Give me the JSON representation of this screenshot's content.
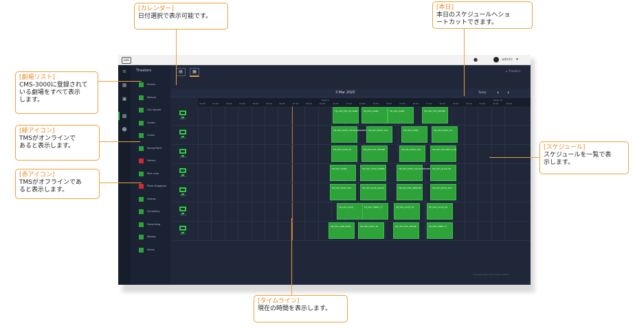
{
  "callouts": {
    "calendar": {
      "title": "[カレンダー]",
      "body": "日付選択で表示可能です。"
    },
    "today": {
      "title": "[本日]",
      "body": "本日のスケジュールへショ\nートカットできます。"
    },
    "theater_list": {
      "title": "[劇場リスト]",
      "body": "CMS-3000に登録されて\nいる劇場をすべて表示\nします。"
    },
    "green_icon": {
      "title": "[緑アイコン]",
      "body": "TMSがオンラインで\nあると表示します。"
    },
    "red_icon": {
      "title": "[赤アイコン]",
      "body": "TMSがオフラインであ\nると表示します。"
    },
    "schedule": {
      "title": "[スケジュール]",
      "body": "スケジュールを一覧で表\n示します。"
    },
    "timeline": {
      "title": "[タイムライン]",
      "body": "現在の時間を表示します。"
    }
  },
  "app": {
    "logo": "GDC",
    "help_icon": "help-icon",
    "user": "admin",
    "sidebar_heading": "Theaters",
    "theaters": [
      {
        "name": "Screen",
        "status": "online"
      },
      {
        "name": "Bellvue",
        "status": "online"
      },
      {
        "name": "City Square",
        "status": "online"
      },
      {
        "name": "Centre",
        "status": "online"
      },
      {
        "name": "Crown",
        "status": "online"
      },
      {
        "name": "Spring Point",
        "status": "online"
      },
      {
        "name": "Harvey",
        "status": "offline"
      },
      {
        "name": "Park Lane",
        "status": "online"
      },
      {
        "name": "Plaza Singapore",
        "status": "offline"
      },
      {
        "name": "Sydney",
        "status": "online"
      },
      {
        "name": "Symphony",
        "status": "online"
      },
      {
        "name": "Hong Kong",
        "status": "online"
      },
      {
        "name": "Melody",
        "status": "online"
      },
      {
        "name": "Nexus",
        "status": "online"
      }
    ],
    "date": "3 Mar 2020",
    "today_label": "Today",
    "breadcrumb": "Theaters",
    "weeks": [
      "Week 9",
      "Week 10"
    ],
    "hours": [
      "00:00",
      "01:00",
      "02:00",
      "03:00",
      "04:00",
      "05:00",
      "06:00",
      "07:00",
      "08:00",
      "09:00",
      "10:00",
      "11:00",
      "12:00",
      "13:00",
      "14:00",
      "15:00",
      "16:00",
      "17:00",
      "18:00",
      "19:00",
      "20:00",
      "21:00",
      "22:00",
      "23:00"
    ],
    "screens": [
      {
        "label": "Hall 1",
        "shows": [
          "FB_CPD_FTR_3D_WBW",
          "FB_CPD_SUNB_",
          "FB_CPD_SUBD_",
          "FB_CPD_FTR_3DFMB"
        ]
      },
      {
        "label": "Hall 2",
        "shows": [
          "FB_CPD_DVPS_CN-2D-PREMIERE",
          "FB_CPD_DVPS_TRA",
          "FB_CPD_SUNB_",
          "FB_CPD_DVPS_CR"
        ]
      },
      {
        "label": "Hall 3",
        "shows": [
          "FB_CPD_LOVE_50",
          "FB_CPD_FTR_3DFMB",
          "FB_CPD_DVPS_TRA",
          "FB_CPD_FTR_BHH_S-2D"
        ]
      },
      {
        "label": "Hall 4",
        "shows": [
          "FB_CPD_SUNB_",
          "FB_CPD_LTTLE_WMBR",
          "FB_CPD_DVPS_CN-2D-PREMIERE",
          "FB_CPD_ALICE_3D"
        ]
      },
      {
        "label": "Hall 5",
        "shows": [
          "FB_CPD_DVPS_TRA",
          "FB_CPD_LOVE_ADULT",
          "FB_CPD_FBS_MEMORY",
          "FB_CPD_DVPS_TRA"
        ]
      },
      {
        "label": "Hall 6",
        "shows": [
          "FB_CPD_LOVE_",
          "FB_CPD_FMBLY_FI",
          "FB_CPD_LOVE_2D",
          "FB_CPD_ALICE_3D"
        ]
      },
      {
        "label": "Hall 7",
        "shows": [
          "FB_CPD_CMB_DVPS_",
          "FB_CPD_DVPS_TR",
          "FB_CPD_FTR_3DFMB",
          "FB_CPD_FMBLY_F"
        ]
      }
    ],
    "footer": "Copyright GDC Technology Limited"
  }
}
